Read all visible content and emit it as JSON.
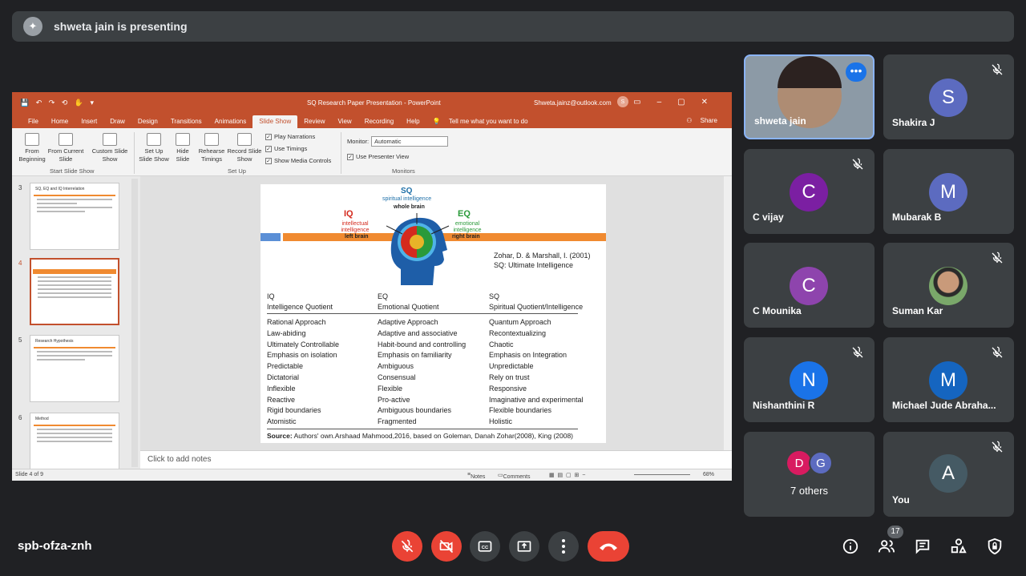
{
  "presenting_banner": {
    "text": "shweta jain is presenting"
  },
  "powerpoint": {
    "quick_access": "💾 ↶ ↷ ⟲ ✋ ▾",
    "window_title": "SQ Research Paper Presentation - PowerPoint",
    "account": "Shweta.jainz@outlook.com",
    "user_initial": "S",
    "tabs": [
      "File",
      "Home",
      "Insert",
      "Draw",
      "Design",
      "Transitions",
      "Animations",
      "Slide Show",
      "Review",
      "View",
      "Recording",
      "Help",
      "Tell me what you want to do"
    ],
    "share_label": "Share",
    "ribbon": {
      "from_beginning": "From Beginning",
      "from_current": "From Current Slide",
      "custom_show": "Custom Slide Show",
      "group_start": "Start Slide Show",
      "set_up_show": "Set Up Slide Show",
      "hide_slide": "Hide Slide",
      "rehearse": "Rehearse Timings",
      "record": "Record Slide Show",
      "play_narrations": "Play Narrations",
      "use_timings": "Use Timings",
      "show_media": "Show Media Controls",
      "group_setup": "Set Up",
      "monitor_label": "Monitor:",
      "monitor_value": "Automatic",
      "presenter_view": "Use Presenter View",
      "group_monitors": "Monitors"
    },
    "thumbnails": [
      {
        "num": "3",
        "title": "SQ, EQ and IQ Interrelation"
      },
      {
        "num": "4",
        "title": ""
      },
      {
        "num": "5",
        "title": "Research Hypothesis"
      },
      {
        "num": "6",
        "title": "Method"
      }
    ],
    "notes_placeholder": "Click to add notes",
    "status": {
      "slide_indicator": "Slide 4 of 9",
      "notes_btn": "Notes",
      "comments_btn": "Comments",
      "zoom": "68%"
    }
  },
  "slide": {
    "sq": "SQ",
    "sq_sub": "spiritual intelligence",
    "whole_brain": "whole brain",
    "iq": "IQ",
    "iq_sub": "intellectual intelligence",
    "eq": "EQ",
    "eq_sub": "emotional intelligence",
    "left_brain": "left brain",
    "right_brain": "right brain",
    "ref_line1": "Zohar, D. & Marshall, I. (2001)",
    "ref_line2": "SQ: Ultimate Intelligence",
    "columns": [
      {
        "abbr": "IQ",
        "name": "Intelligence Quotient",
        "items": [
          "Rational Approach",
          "Law-abiding",
          "Ultimately Controllable",
          "Emphasis on isolation",
          "Predictable",
          "Dictatorial",
          "Inflexible",
          "Reactive",
          "Rigid boundaries",
          "Atomistic"
        ]
      },
      {
        "abbr": "EQ",
        "name": "Emotional Quotient",
        "items": [
          "Adaptive Approach",
          "Adaptive and associative",
          "Habit-bound and controlling",
          "Emphasis on familiarity",
          "Ambiguous",
          "Consensual",
          "Flexible",
          "Pro-active",
          "Ambiguous boundaries",
          "Fragmented"
        ]
      },
      {
        "abbr": "SQ",
        "name": "Spiritual Quotient/Intelligence",
        "items": [
          "Quantum Approach",
          "Recontextualizing",
          "Chaotic",
          "Emphasis on Integration",
          "Unpredictable",
          "Rely on trust",
          "Responsive",
          "Imaginative and experimental",
          "Flexible boundaries",
          "Holistic"
        ]
      }
    ],
    "source_label": "Source:",
    "source_text": "Authors' own.Arshaad Mahmood,2016, based on Goleman, Danah Zohar(2008), King (2008)"
  },
  "participants": [
    {
      "name": "shweta jain",
      "type": "video",
      "active": true
    },
    {
      "name": "Shakira J",
      "initial": "S",
      "color": "#5c6bc0",
      "muted": true
    },
    {
      "name": "C vijay",
      "initial": "C",
      "color": "#7b1fa2",
      "muted": true
    },
    {
      "name": "Mubarak B",
      "initial": "M",
      "color": "#5c6bc0",
      "muted": false
    },
    {
      "name": "C Mounika",
      "initial": "C",
      "color": "#8e44ad",
      "muted": false
    },
    {
      "name": "Suman Kar",
      "type": "photo",
      "muted": true
    },
    {
      "name": "Nishanthini R",
      "initial": "N",
      "color": "#1a73e8",
      "muted": true
    },
    {
      "name": "Michael Jude Abraha...",
      "initial": "M",
      "color": "#1565c0",
      "muted": true
    },
    {
      "name": "7 others",
      "initials": [
        "D",
        "G"
      ],
      "colors": [
        "#d81b60",
        "#5c6bc0"
      ]
    },
    {
      "name": "You",
      "initial": "A",
      "color": "#455a64",
      "muted": true
    }
  ],
  "meeting": {
    "code": "spb-ofza-znh",
    "people_count": "17"
  }
}
